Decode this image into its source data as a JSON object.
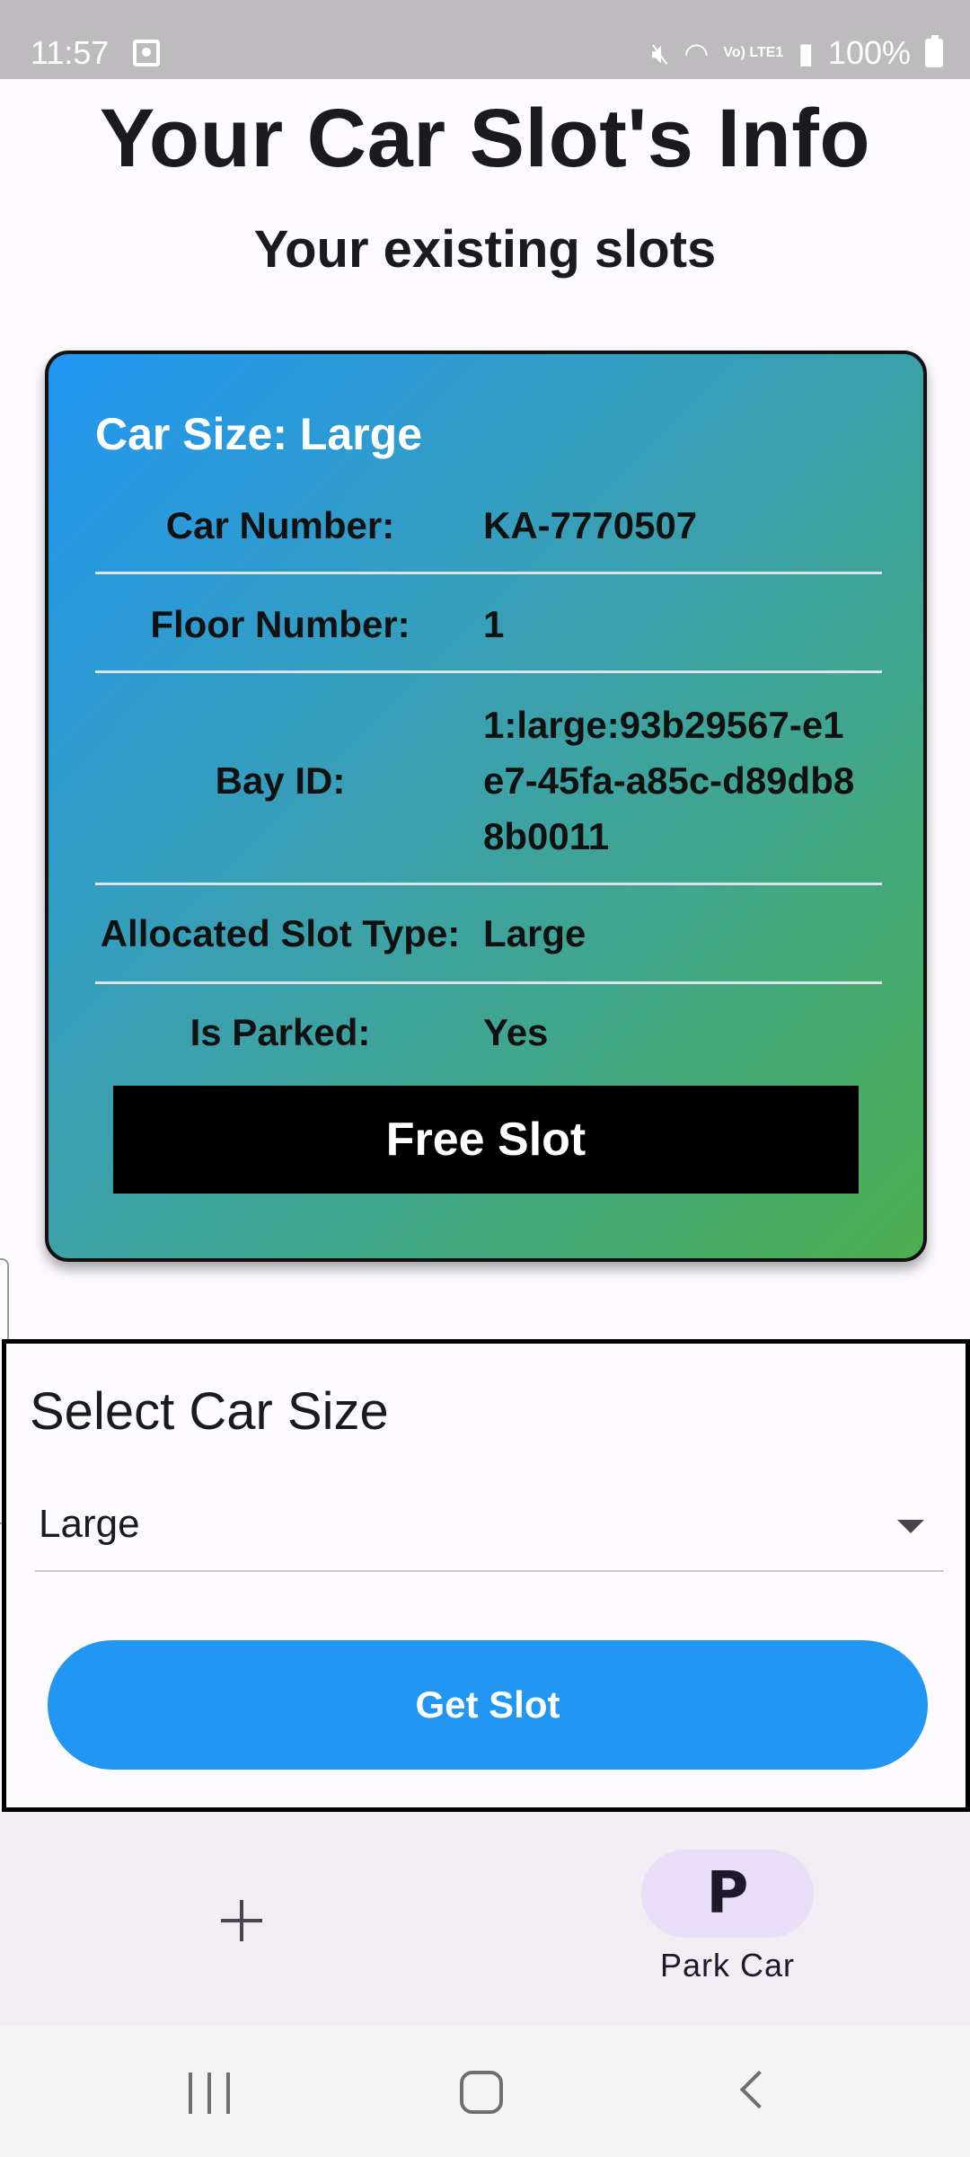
{
  "status_bar": {
    "time": "11:57",
    "battery": "100%",
    "network": "Vo) LTE1"
  },
  "header": {
    "title": "Your Car Slot's Info",
    "subtitle": "Your existing slots"
  },
  "slot_card": {
    "car_size": "Car Size: Large",
    "rows": [
      {
        "label": "Car Number:",
        "value": "KA-7770507"
      },
      {
        "label": "Floor Number:",
        "value": "1"
      },
      {
        "label": "Bay ID:",
        "value": "1:large:93b29567-e1e7-45fa-a85c-d89db88b0011"
      },
      {
        "label": "Allocated Slot Type:",
        "value": "Large"
      },
      {
        "label": "Is Parked:",
        "value": "Yes"
      }
    ],
    "free_slot_label": "Free Slot",
    "gradient_colors": [
      "#2196f3",
      "#4caf50"
    ]
  },
  "select_panel": {
    "label": "Select Car Size",
    "selected_size": "Large",
    "get_slot_label": "Get Slot",
    "button_color": "#2196f3"
  },
  "bottom_nav": {
    "items": [
      {
        "icon": "plus-icon",
        "label": ""
      },
      {
        "icon": "parking-icon",
        "icon_text": "P",
        "label": "Park Car",
        "active": true
      }
    ]
  },
  "system_nav": {
    "icons": [
      "recents-icon",
      "home-icon",
      "back-icon"
    ]
  }
}
